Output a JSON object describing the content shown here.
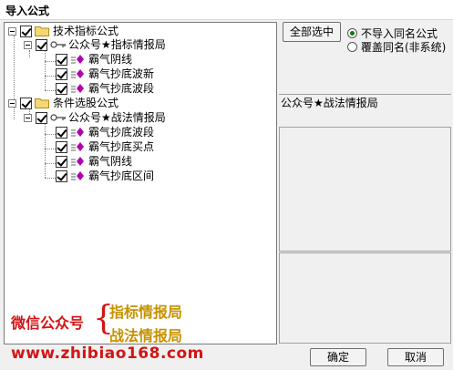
{
  "window": {
    "title": "导入公式"
  },
  "tree": {
    "groups": [
      {
        "label": "技术指标公式",
        "author": "公众号★指标情报局",
        "items": [
          "霸气阴线",
          "霸气抄底波新",
          "霸气抄底波段"
        ]
      },
      {
        "label": "条件选股公式",
        "author": "公众号★战法情报局",
        "items": [
          "霸气抄底波段",
          "霸气抄底买点",
          "霸气阴线",
          "霸气抄底区间"
        ]
      }
    ]
  },
  "watermark": {
    "wechat": "微信公众号",
    "brace": "{",
    "line1": "指标情报局",
    "line2": "战法情报局",
    "url": "www.zhibiao168.com"
  },
  "controls": {
    "select_all": "全部选中",
    "radio_skip": "不导入同名公式",
    "radio_overwrite": "覆盖同名(非系统)",
    "ok": "确定",
    "cancel": "取消"
  },
  "info": {
    "selected_author": "公众号★战法情报局"
  },
  "colors": {
    "watermark_red": "#d41414",
    "watermark_gold": "#c79200",
    "formula_purple": "#b000b0",
    "radio_green": "#0a7a0a"
  }
}
